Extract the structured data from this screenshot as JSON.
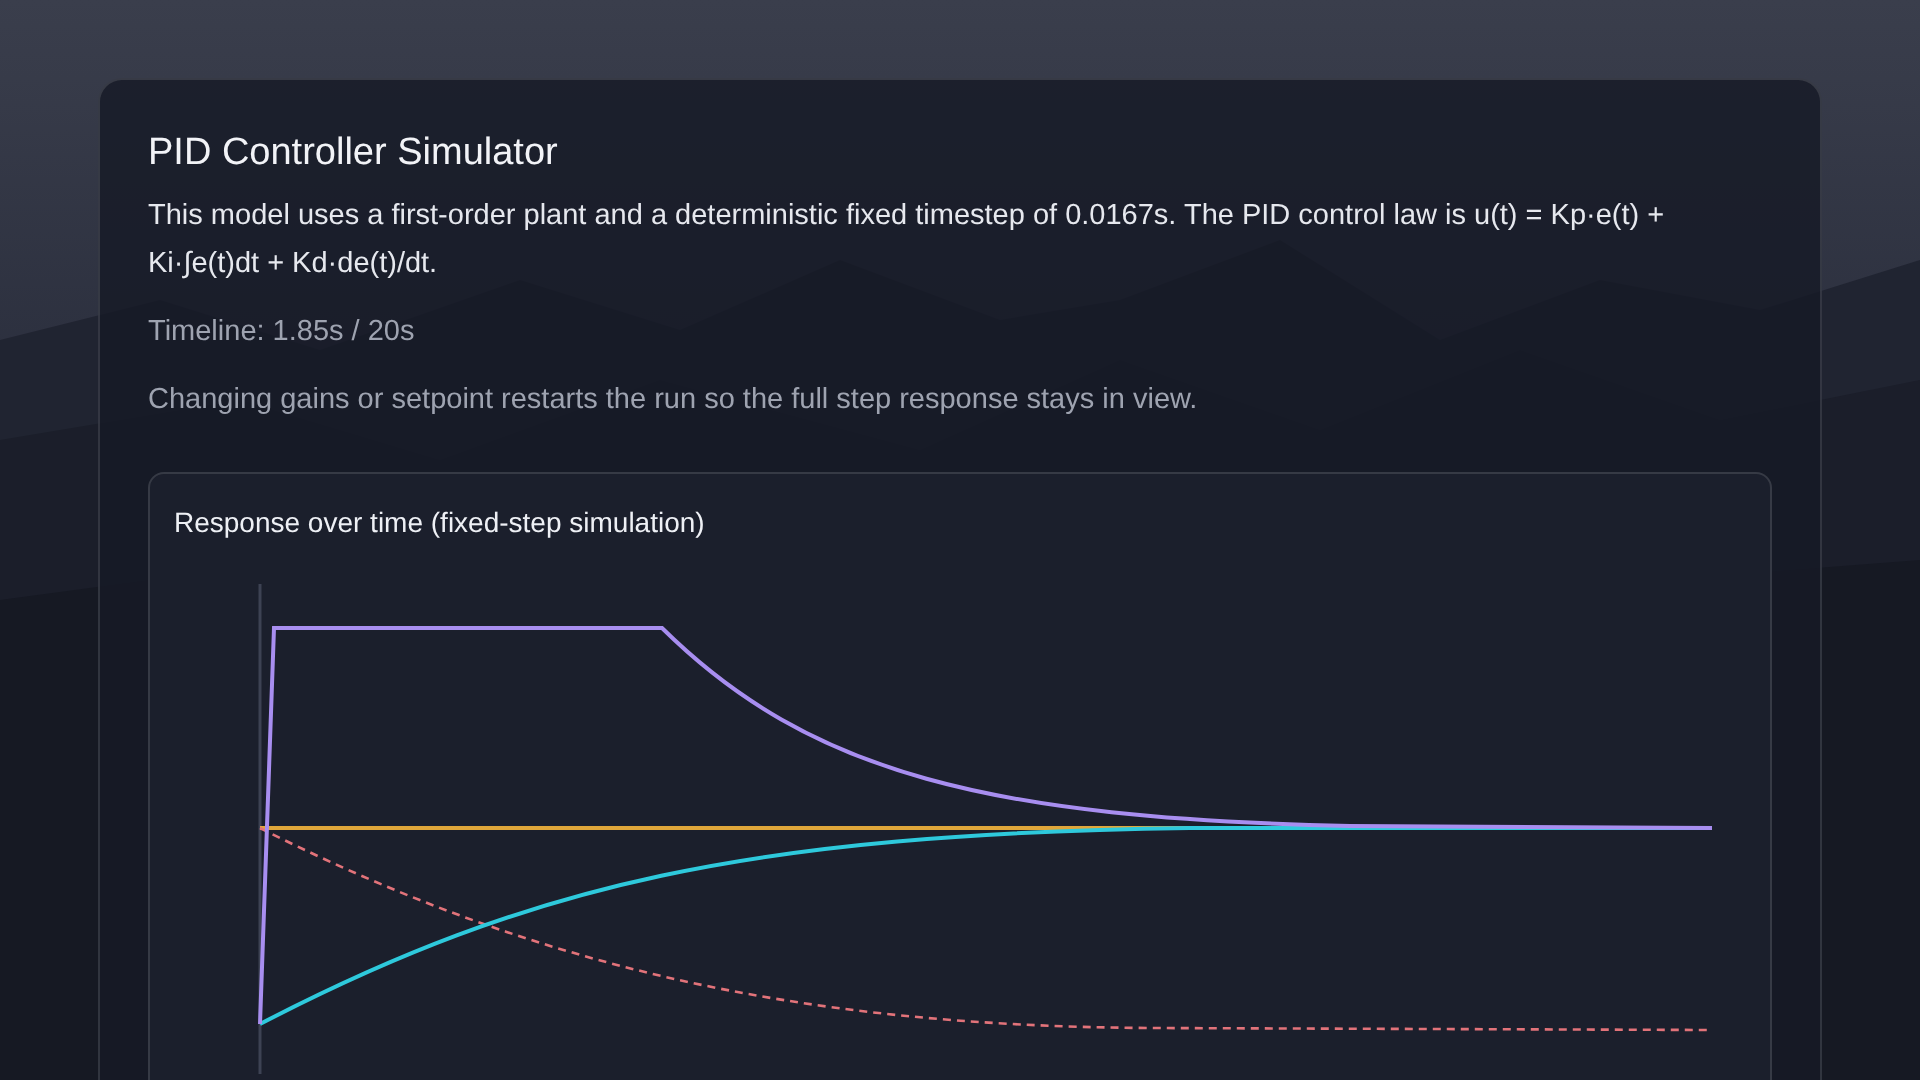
{
  "card": {
    "title": "PID Controller Simulator",
    "description": "This model uses a first-order plant and a deterministic fixed timestep of 0.0167s. The PID control law is u(t) = Kp·e(t) + Ki·∫e(t)dt + Kd·de(t)/dt.",
    "timeline": "Timeline: 1.85s / 20s",
    "note": "Changing gains or setpoint restarts the run so the full step response stays in view."
  },
  "chart_panel": {
    "title": "Response over time (fixed-step simulation)"
  }
}
